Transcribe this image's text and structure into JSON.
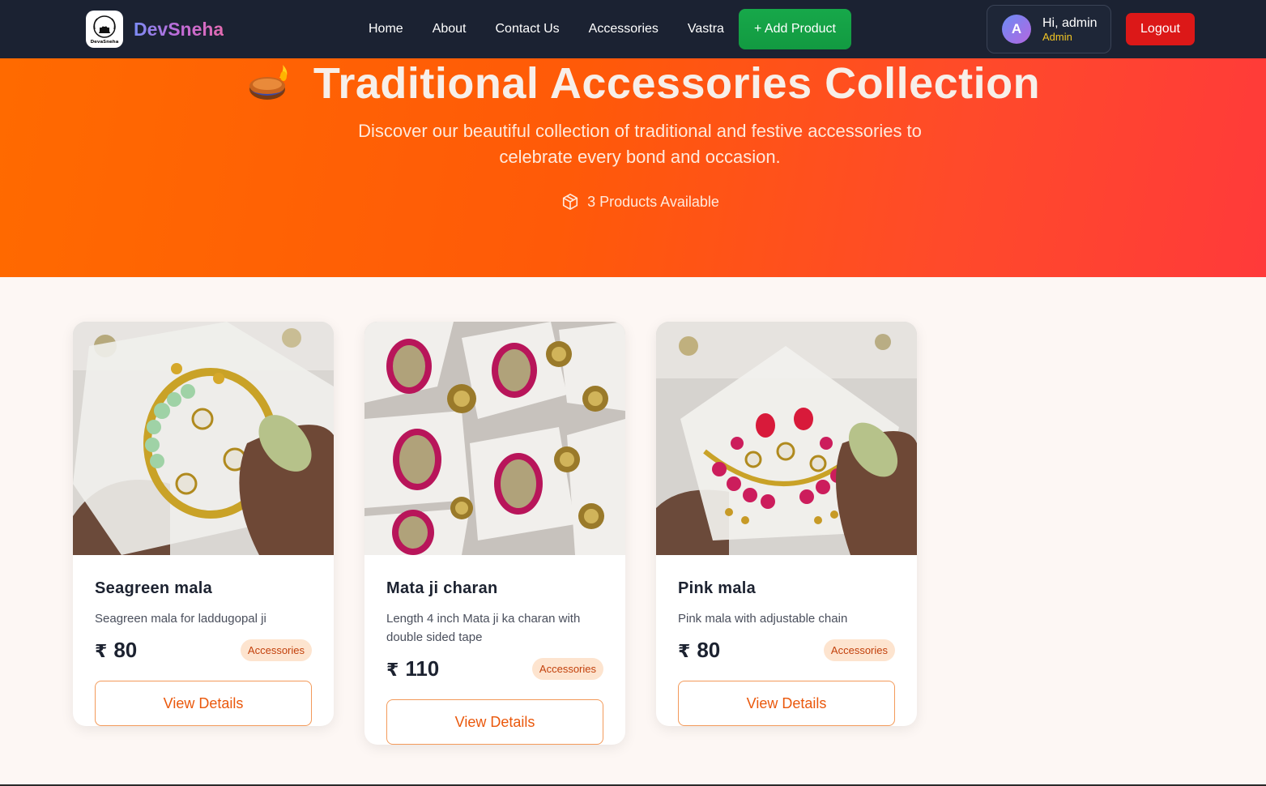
{
  "brand": {
    "name": "DevSneha",
    "logo_caption": "DevaSneha"
  },
  "nav": {
    "links": [
      "Home",
      "About",
      "Contact Us",
      "Accessories",
      "Vastra"
    ],
    "add_product": "+ Add Product"
  },
  "user": {
    "initial": "A",
    "greeting": "Hi, admin",
    "role": "Admin",
    "logout": "Logout"
  },
  "hero": {
    "title": "Traditional Accessories Collection",
    "subtitle": "Discover our beautiful collection of traditional and festive accessories to celebrate every bond and occasion.",
    "count_text": "3 Products Available"
  },
  "products": [
    {
      "name": "Seagreen mala",
      "description": "Seagreen mala for laddugopal ji",
      "currency": "₹",
      "price": "80",
      "category": "Accessories",
      "button": "View Details"
    },
    {
      "name": "Mata ji charan",
      "description": "Length 4 inch Mata ji ka charan with double sided tape",
      "currency": "₹",
      "price": "110",
      "category": "Accessories",
      "button": "View Details"
    },
    {
      "name": "Pink mala",
      "description": "Pink mala with adjustable chain",
      "currency": "₹",
      "price": "80",
      "category": "Accessories",
      "button": "View Details"
    }
  ],
  "colors": {
    "nav_bg": "#1b2232",
    "hero_start": "#ff6a00",
    "hero_end": "#ff3a3a",
    "accent": "#ea580c",
    "add_product": "#16a34a",
    "logout": "#dc1818"
  }
}
